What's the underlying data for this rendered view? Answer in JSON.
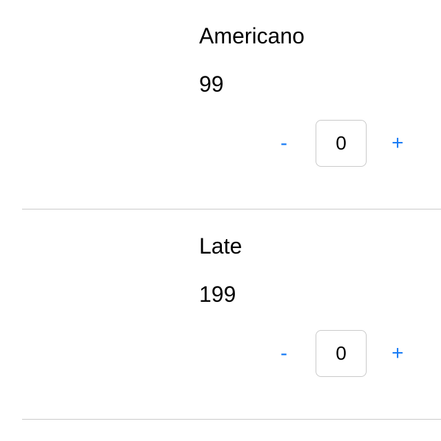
{
  "items": [
    {
      "name": "Americano",
      "price": "99",
      "quantity": "0",
      "decrement_label": "-",
      "increment_label": "+"
    },
    {
      "name": "Late",
      "price": "199",
      "quantity": "0",
      "decrement_label": "-",
      "increment_label": "+"
    }
  ],
  "colors": {
    "accent": "#1a7cf5",
    "divider": "#c8c8c8",
    "border": "#c8c8c8"
  }
}
